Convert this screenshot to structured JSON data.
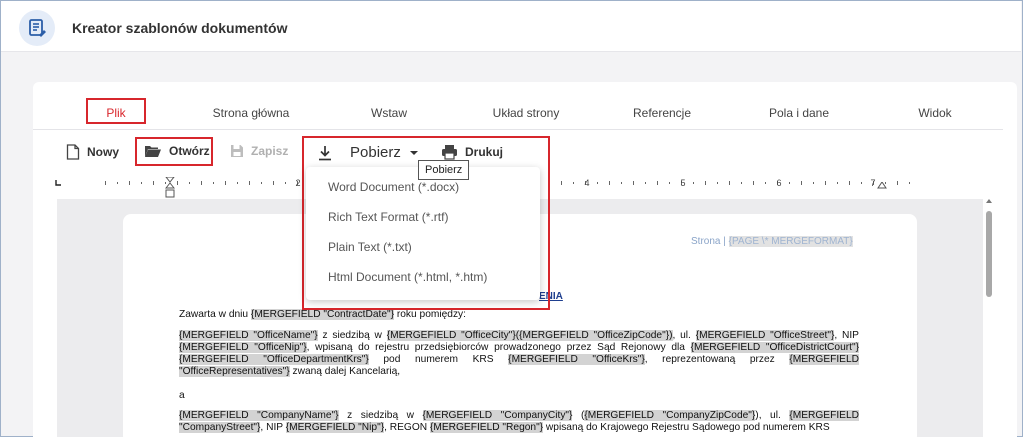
{
  "app": {
    "title": "Kreator szablonów dokumentów"
  },
  "tabs": [
    {
      "label": "Plik"
    },
    {
      "label": "Strona główna"
    },
    {
      "label": "Wstaw"
    },
    {
      "label": "Układ strony"
    },
    {
      "label": "Referencje"
    },
    {
      "label": "Pola i dane"
    },
    {
      "label": "Widok"
    }
  ],
  "toolbar": {
    "new_label": "Nowy",
    "open_label": "Otwórz",
    "save_label": "Zapisz",
    "download_label": "Pobierz",
    "print_label": "Drukuj"
  },
  "ruler": {
    "numbers": [
      "1",
      "2",
      "3",
      "4",
      "5",
      "6",
      "7"
    ]
  },
  "tooltip": {
    "text": "Pobierz"
  },
  "download_menu": {
    "items": [
      {
        "label": "Word Document (*.docx)"
      },
      {
        "label": "Rich Text Format (*.rtf)"
      },
      {
        "label": "Plain Text (*.txt)"
      },
      {
        "label": "Html Document (*.html, *.htm)"
      }
    ]
  },
  "document": {
    "header_prefix": "Strona | ",
    "header_field": "{PAGE \\* MERGEFORMAT}",
    "title_fragment": "ENIA",
    "p1_a": "Zawarta w dniu ",
    "p1_field": "{MERGEFIELD \"ContractDate\"}",
    "p1_b": " roku pomiędzy:",
    "p2_f1": "{MERGEFIELD \"OfficeName\"}",
    "p2_t1": " z siedzibą w ",
    "p2_f2": "{MERGEFIELD \"OfficeCity\"}({MERGEFIELD \"OfficeZipCode\"})",
    "p2_t2": ", ul. ",
    "p2_f3": "{MERGEFIELD \"OfficeStreet\"}",
    "p2_t3": ", NIP ",
    "p2_f4": "{MERGEFIELD \"OfficeNip\"}",
    "p2_t4": ", wpisaną do rejestru przedsiębiorców prowadzonego przez Sąd Rejonowy dla ",
    "p2_f5": "{MERGEFIELD \"OfficeDistrictCourt\"}",
    "p2_t5": " ",
    "p2_f6": "{MERGEFIELD \"OfficeDepartmentKrs\"}",
    "p2_t6": " pod numerem KRS ",
    "p2_f7": "{MERGEFIELD \"OfficeKrs\"}",
    "p2_t7": ", reprezentowaną przez ",
    "p2_f8": "{MERGEFIELD \"OfficeRepresentatives\"}",
    "p2_t8": " zwaną dalej Kancelarią,",
    "p3": "a",
    "p4_f1": "{MERGEFIELD \"CompanyName\"}",
    "p4_t1": " z siedzibą w ",
    "p4_f2": "{MERGEFIELD \"CompanyCity\"}",
    "p4_t2": " (",
    "p4_f3": "{MERGEFIELD \"CompanyZipCode\"}",
    "p4_t3": "), ul. ",
    "p4_f4": "{MERGEFIELD \"CompanyStreet\"}",
    "p4_t4": ", NIP ",
    "p4_f5": "{MERGEFIELD \"Nip\"}",
    "p4_t5": ", REGON ",
    "p4_f6": "{MERGEFIELD \"Regon\"}",
    "p4_t6": " wpisaną do Krajowego Rejestru Sądowego pod numerem KRS"
  },
  "colors": {
    "accent_red": "#d7262c",
    "icon_blue": "#2b5ea8"
  }
}
